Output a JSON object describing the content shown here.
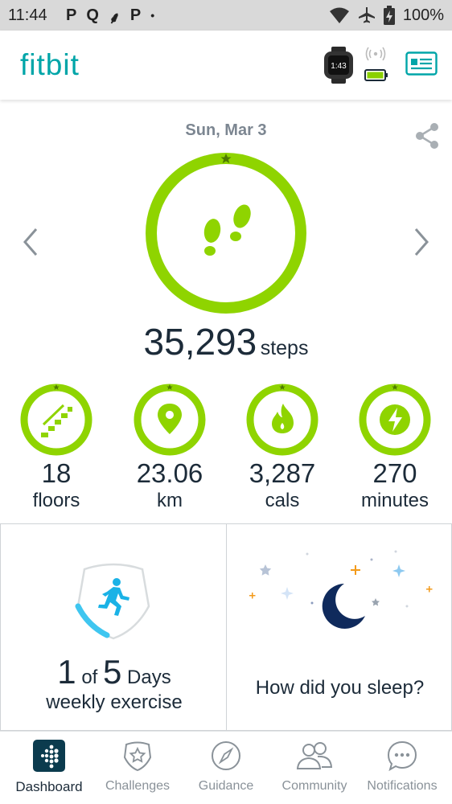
{
  "status_bar": {
    "time": "11:44",
    "notification_icons": [
      "P",
      "Q",
      "⸙",
      "P",
      "•"
    ],
    "battery": "100%",
    "icons": [
      "wifi-icon",
      "airplane-icon",
      "battery-charging-icon"
    ]
  },
  "app_bar": {
    "logo": "fitbit",
    "watch_display": "1:43",
    "colors": {
      "brand": "#00a5a8",
      "battery": "#8ad000"
    }
  },
  "dashboard": {
    "date": "Sun, Mar 3",
    "steps_value": "35,293",
    "steps_unit": "steps",
    "ring_color": "#8fd400",
    "stats": [
      {
        "value": "18",
        "unit": "floors",
        "icon": "stairs-icon"
      },
      {
        "value": "23.06",
        "unit": "km",
        "icon": "location-pin-icon"
      },
      {
        "value": "3,287",
        "unit": "cals",
        "icon": "flame-icon"
      },
      {
        "value": "270",
        "unit": "minutes",
        "icon": "lightning-bolt-icon"
      }
    ]
  },
  "tiles": {
    "exercise": {
      "count": "1",
      "of": "of",
      "total": "5",
      "days": "Days",
      "caption": "weekly exercise",
      "progress_fraction": 0.2
    },
    "sleep": {
      "prompt": "How did you sleep?"
    }
  },
  "bottom_nav": {
    "items": [
      {
        "label": "Dashboard",
        "icon": "dashboard-dots-icon",
        "active": true
      },
      {
        "label": "Challenges",
        "icon": "star-badge-icon",
        "active": false
      },
      {
        "label": "Guidance",
        "icon": "compass-icon",
        "active": false
      },
      {
        "label": "Community",
        "icon": "people-icon",
        "active": false
      },
      {
        "label": "Notifications",
        "icon": "chat-bubble-icon",
        "active": false
      }
    ]
  }
}
